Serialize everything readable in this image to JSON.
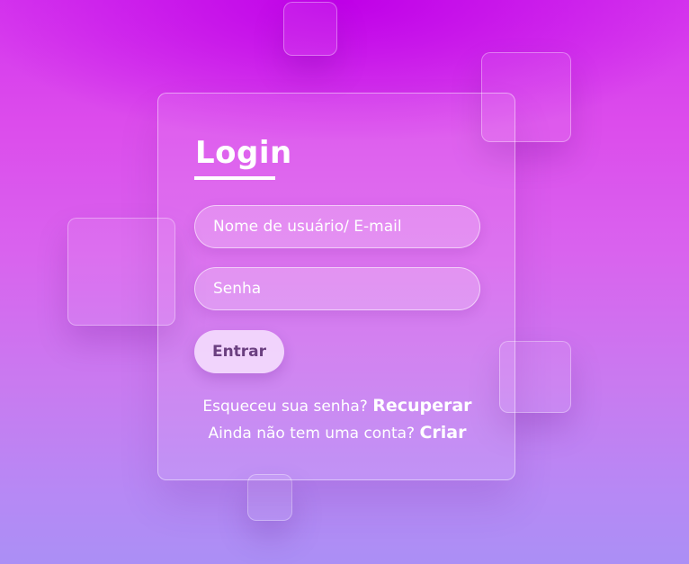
{
  "login": {
    "title": "Login",
    "username_placeholder": "Nome de usuário/ E-mail",
    "password_placeholder": "Senha",
    "submit_label": "Entrar",
    "forgot_text": "Esqueceu sua senha?",
    "forgot_link": "Recuperar",
    "signup_text": "Ainda não tem uma conta?",
    "signup_link": "Criar"
  }
}
